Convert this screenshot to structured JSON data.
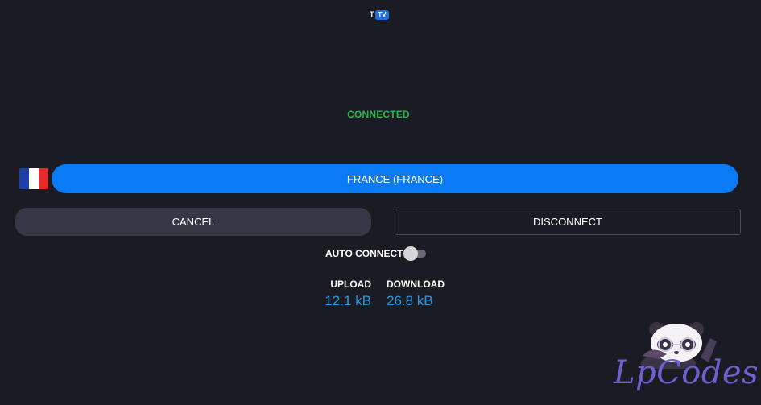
{
  "app": {
    "logo_letter": "T",
    "logo_badge": "TV"
  },
  "status": {
    "text": "CONNECTED",
    "color": "#1fba4f"
  },
  "server": {
    "label": "FRANCE (FRANCE)",
    "flag_colors": [
      "#1f3fa8",
      "#ffffff",
      "#e32b2b"
    ],
    "accent": "#0a7bf5"
  },
  "actions": {
    "cancel_label": "CANCEL",
    "disconnect_label": "DISCONNECT"
  },
  "auto_connect": {
    "label": "AUTO CONNECT",
    "enabled": false
  },
  "stats": {
    "upload_label": "UPLOAD",
    "upload_value": "12.1 kB",
    "download_label": "DOWNLOAD",
    "download_value": "26.8 kB",
    "value_color": "#1e9be8"
  },
  "watermark": {
    "text": "LpCodes",
    "icon": "panda-mascot-icon"
  }
}
